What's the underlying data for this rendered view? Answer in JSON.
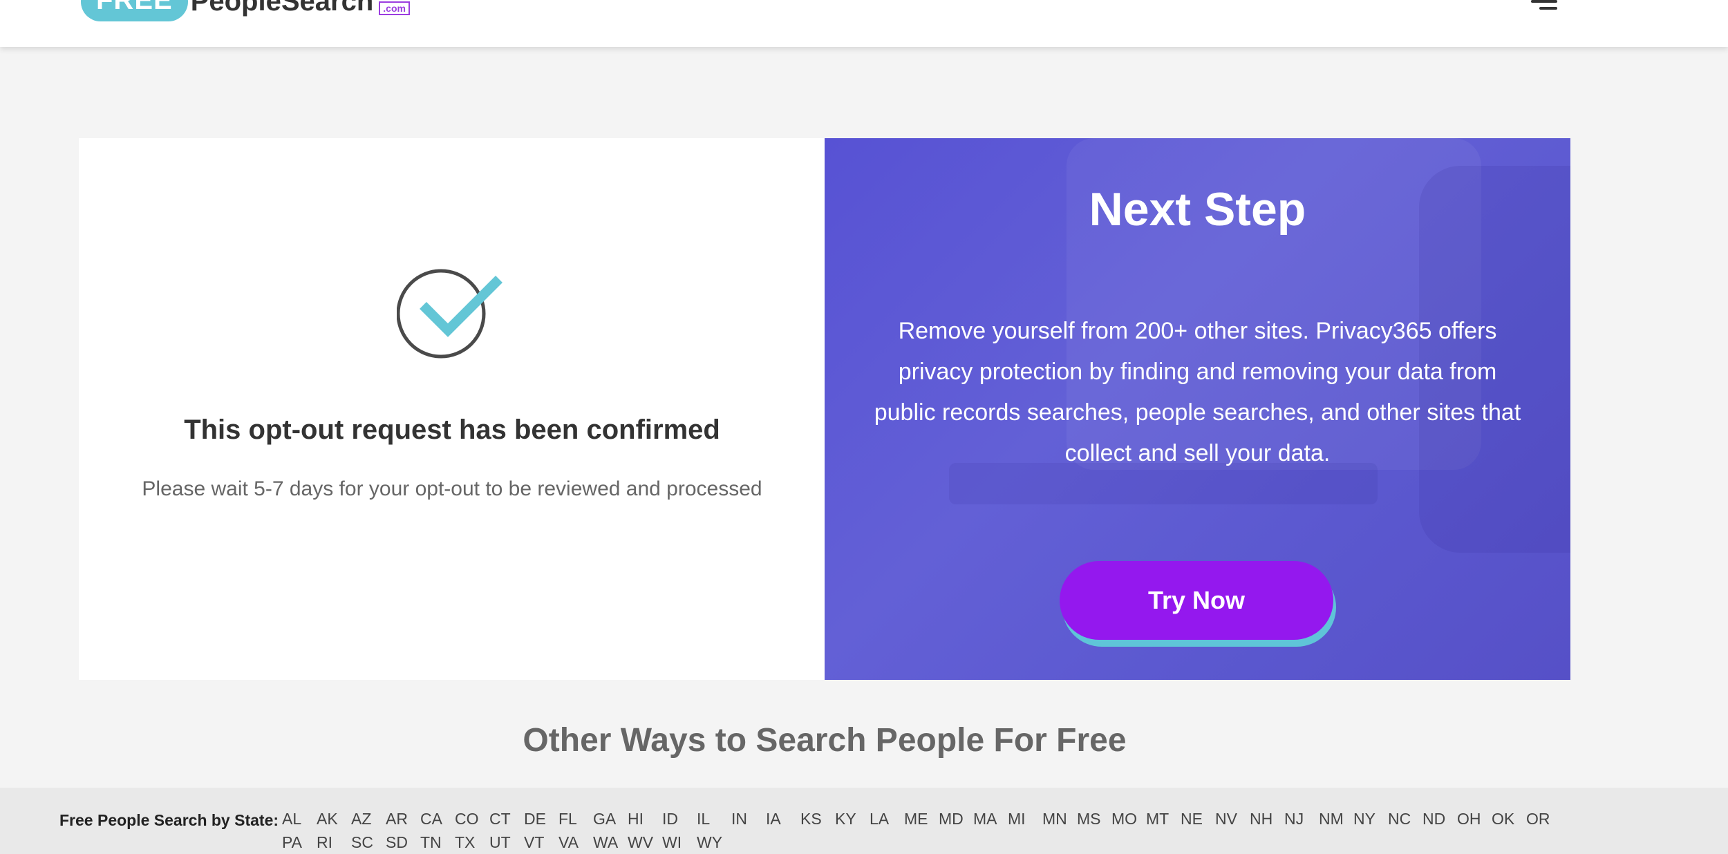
{
  "header": {
    "logo": {
      "free": "FREE",
      "people_search": "PeopleSearch",
      "com": ".com"
    }
  },
  "confirmation": {
    "title": "This opt-out request has been confirmed",
    "subtitle": "Please wait 5-7 days for your opt-out to be reviewed and processed"
  },
  "next_step": {
    "title": "Next Step",
    "description": "Remove yourself from 200+ other sites. Privacy365 offers privacy protection by finding and removing your data from public records searches, people searches, and other sites that collect and sell your data.",
    "button_label": "Try Now"
  },
  "other_ways": {
    "title": "Other Ways to Search People For Free"
  },
  "footer": {
    "states_label": "Free People Search by State:",
    "states": [
      "AL",
      "AK",
      "AZ",
      "AR",
      "CA",
      "CO",
      "CT",
      "DE",
      "FL",
      "GA",
      "HI",
      "ID",
      "IL",
      "IN",
      "IA",
      "KS",
      "KY",
      "LA",
      "ME",
      "MD",
      "MA",
      "MI",
      "MN",
      "MS",
      "MO",
      "MT",
      "NE",
      "NV",
      "NH",
      "NJ",
      "NM",
      "NY",
      "NC",
      "ND",
      "OH",
      "OK",
      "OR",
      "PA",
      "RI",
      "SC",
      "SD",
      "TN",
      "TX",
      "UT",
      "VT",
      "VA",
      "WA",
      "WV",
      "WI",
      "WY"
    ]
  },
  "colors": {
    "accent_cyan": "#63c6d6",
    "accent_purple": "#9418ee",
    "panel_blue": "#5a56d3"
  }
}
